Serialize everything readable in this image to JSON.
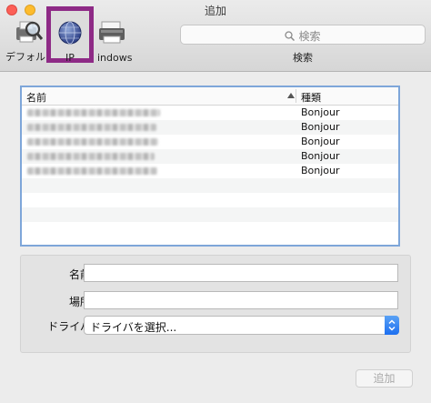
{
  "window": {
    "title": "追加"
  },
  "toolbar": {
    "items": [
      {
        "label": "デフォルト",
        "icon": "default-printer-icon"
      },
      {
        "label": "IP",
        "icon": "globe-icon"
      },
      {
        "label": "indows",
        "icon": "windows-printer-icon"
      }
    ],
    "search_placeholder": "検索",
    "search_caption": "検索"
  },
  "list": {
    "columns": {
      "name": "名前",
      "kind": "種類"
    },
    "rows": [
      {
        "kind": "Bonjour"
      },
      {
        "kind": "Bonjour"
      },
      {
        "kind": "Bonjour"
      },
      {
        "kind": "Bonjour"
      },
      {
        "kind": "Bonjour"
      }
    ]
  },
  "form": {
    "name_label": "名前:",
    "name_value": "",
    "location_label": "場所:",
    "location_value": "",
    "driver_label": "ドライバ:",
    "driver_value": "ドライバを選択..."
  },
  "footer": {
    "add_button": "追加"
  },
  "colors": {
    "highlight": "#8e2a86",
    "list_focus": "#7ea6d9",
    "select_accent": "#1d6ff0"
  }
}
